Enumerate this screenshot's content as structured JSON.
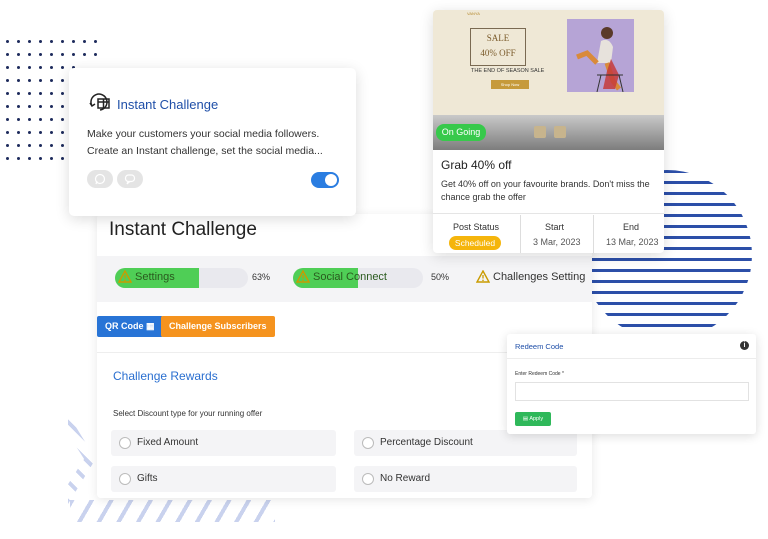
{
  "main": {
    "title": "Instant Challenge",
    "progress": [
      {
        "label": "Settings",
        "percent_text": "63%",
        "fill": 0.63
      },
      {
        "label": "Social Connect",
        "percent_text": "50%",
        "fill": 0.5
      },
      {
        "label": "Challenges Setting",
        "percent_text": "",
        "fill": 0
      }
    ],
    "buttons": {
      "qr": "QR Code",
      "subscribers": "Challenge Subscribers"
    },
    "rewards": {
      "title": "Challenge Rewards",
      "subtitle": "Select Discount type for your running offer",
      "options": [
        "Fixed Amount",
        "Percentage Discount",
        "Gifts",
        "No Reward"
      ]
    }
  },
  "instant_card": {
    "title": "Instant Challenge",
    "description": "Make your customers your social media followers. Create an Instant challenge, set the social media...",
    "toggle_on": true,
    "chips": [
      "whatsapp-icon",
      "chat-bubble-icon"
    ]
  },
  "promo": {
    "banner": {
      "brand": "VANYA",
      "sale_line1": "SALE",
      "sale_line2": "40% OFF",
      "subtitle": "THE END OF SEASON SALE",
      "shop_button": "Shop Now"
    },
    "status_badge": "On Going",
    "title": "Grab 40% off",
    "description": "Get 40% off on your favourite brands. Don't miss the chance grab the offer",
    "stats": {
      "post_status_label": "Post Status",
      "post_status_value": "Scheduled",
      "start_label": "Start",
      "start_value": "3 Mar, 2023",
      "end_label": "End",
      "end_value": "13 Mar, 2023"
    }
  },
  "redeem": {
    "title": "Redeem Code",
    "field_label": "Enter Redeem Code *",
    "field_value": "",
    "apply_label": "Apply"
  },
  "colors": {
    "accent_blue": "#2874d6",
    "accent_orange": "#f5931e",
    "progress_green": "#4fce56",
    "badge_green": "#37c94b",
    "badge_yellow": "#f5b50c",
    "apply_green": "#2fb85a"
  }
}
